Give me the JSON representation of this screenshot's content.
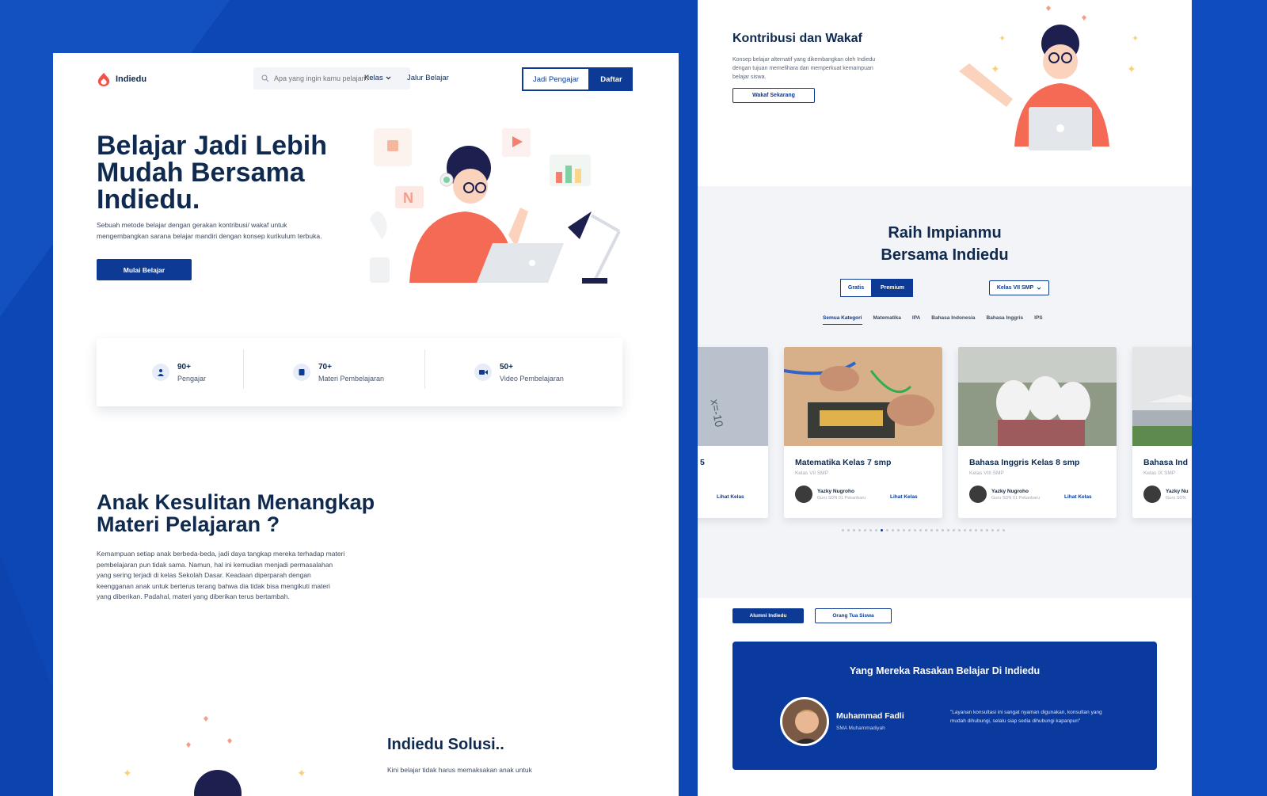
{
  "nav": {
    "brand": "Indiedu",
    "search_placeholder": "Apa yang ingin kamu pelajari?",
    "kelas": "Kelas",
    "jalur": "Jalur Belajar",
    "jadi_pengajar": "Jadi Pengajar",
    "daftar": "Daftar"
  },
  "hero": {
    "title": "Belajar Jadi Lebih Mudah Bersama Indiedu.",
    "desc": "Sebuah metode belajar dengan gerakan kontribusi/ wakaf untuk mengembangkan sarana belajar mandiri dengan konsep kurikulum terbuka.",
    "cta": "Mulai Belajar"
  },
  "stats": [
    {
      "num": "90+",
      "label": "Pengajar"
    },
    {
      "num": "70+",
      "label": "Materi Pembelajaran"
    },
    {
      "num": "50+",
      "label": "Video Pembelajaran"
    }
  ],
  "problem": {
    "title": "Anak Kesulitan Menangkap Materi Pelajaran ?",
    "desc": "Kemampuan setiap anak berbeda-beda, jadi daya tangkap mereka terhadap materi pembelajaran pun tidak sama. Namun, hal ini kemudian menjadi permasalahan yang sering terjadi di kelas Sekolah Dasar. Keadaan diperparah dengan keengganan anak untuk berterus terang bahwa dia tidak bisa mengikuti materi yang diberikan. Padahal, materi yang diberikan terus bertambah."
  },
  "solution": {
    "title": "Indiedu Solusi..",
    "desc": "Kini belajar tidak harus memaksakan anak untuk"
  },
  "wakaf": {
    "title": "Kontribusi dan Wakaf",
    "desc": "Konsep belajar alternatif yang dikembangkan oleh Indiedu dengan tujuan memelihara dan memperkuat kemampuan belajar siswa.",
    "button": "Wakaf Sekarang"
  },
  "courses": {
    "title": "Raih Impianmu Bersama Indiedu",
    "toggle": [
      "Gratis",
      "Premium"
    ],
    "select": "Kelas VII SMP",
    "categories": [
      "Semua Kategori",
      "Matematika",
      "IPA",
      "Bahasa Indonesia",
      "Bahasa Inggris",
      "IPS"
    ],
    "cards": [
      {
        "title": "5",
        "sub": "",
        "author": "",
        "role": "",
        "link": "Lihat Kelas"
      },
      {
        "title": "Matematika Kelas 7 smp",
        "sub": "Kelas VII SMP",
        "author": "Yazky Nugroho",
        "role": "Guru SDN 01 Pekanbaru",
        "link": "Lihat Kelas"
      },
      {
        "title": "Bahasa Inggris Kelas 8 smp",
        "sub": "Kelas VIII SMP",
        "author": "Yazky Nugroho",
        "role": "Guru SDN 01 Pekanbaru",
        "link": "Lihat Kelas"
      },
      {
        "title": "Bahasa Ind",
        "sub": "Kelas IX SMP",
        "author": "Yazky Nu",
        "role": "Guru SDN",
        "link": ""
      }
    ],
    "dots_total": 30,
    "dots_active": 7
  },
  "testimonial": {
    "tabs": [
      "Alumni Indiedu",
      "Orang Tua Siswa"
    ],
    "title": "Yang Mereka Rasakan Belajar Di Indiedu",
    "name": "Muhammad Fadli",
    "school": "SMA Muhammadiyah",
    "quote": "\"Layanan konsultasi ini sangat nyaman digunakan, konsultan yang mudah dihubungi, selalu siap sedia dihubungi kapanpun\""
  },
  "colors": {
    "primary": "#0c3a94",
    "background": "#0d47b5",
    "accent": "#f46a55"
  }
}
